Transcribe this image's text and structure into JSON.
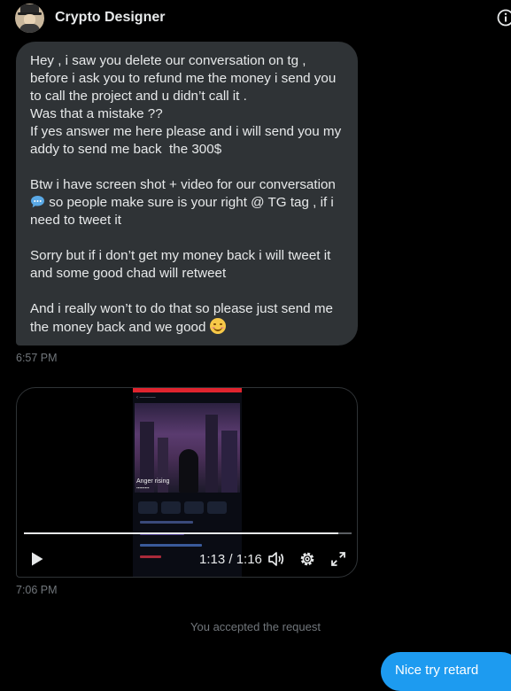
{
  "header": {
    "name": "Crypto Designer",
    "avatar_icon": "profile-avatar",
    "info_icon": "info-icon"
  },
  "messages": {
    "incoming_text": {
      "p1": "Hey , i saw you delete our conversation on tg ,\nbefore i ask you to refund me the money i send you to call the project and u didn’t call it .\nWas that a mistake ??\nIf yes answer me here please and i will send you my addy to send me back  the 300$",
      "p2_before": "Btw i have screen shot + video for our conversation ",
      "p2_emoji": "speech-balloon-emoji",
      "p2_after": " so people make sure is your right @ TG tag , if i need to tweet it",
      "p3": "Sorry but if i don’t get my money back i will tweet it and some good chad will retweet",
      "p4_before": "And i really won’t to do that so please just send me the money back and we good ",
      "p4_emoji": "smiling-face-emoji",
      "time": "6:57 PM"
    },
    "video": {
      "embedded_title": "Anger rising",
      "time_display": "1:13 / 1:16",
      "progress": 0.96,
      "time": "7:06 PM"
    },
    "system_notice": "You accepted the request",
    "outgoing_text": "Nice try retard"
  },
  "colors": {
    "background": "#000000",
    "bubble_incoming": "#2f3336",
    "bubble_outgoing": "#1d9bf0",
    "muted_text": "#71767b"
  }
}
